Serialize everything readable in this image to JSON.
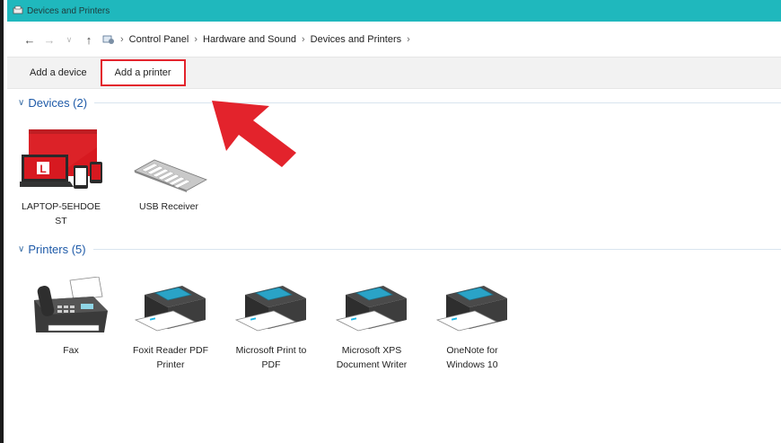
{
  "window": {
    "title": "Devices and Printers"
  },
  "address": {
    "back_icon": "arrow-left-icon",
    "forward_icon": "arrow-right-icon",
    "recent_icon": "chevron-down-icon",
    "up_icon": "arrow-up-icon",
    "crumbs": [
      "Control Panel",
      "Hardware and Sound",
      "Devices and Printers"
    ]
  },
  "commands": {
    "add_device": "Add a device",
    "add_printer": "Add a printer"
  },
  "devices": {
    "header": "Devices (2)",
    "items": [
      {
        "label": "LAPTOP-5EHDOE ST",
        "icon": "laptop-icon"
      },
      {
        "label": "USB Receiver",
        "icon": "keyboard-icon"
      }
    ]
  },
  "printers": {
    "header": "Printers (5)",
    "items": [
      {
        "label": "Fax",
        "icon": "fax-icon"
      },
      {
        "label": "Foxit Reader PDF Printer",
        "icon": "printer-icon"
      },
      {
        "label": "Microsoft Print to PDF",
        "icon": "printer-icon"
      },
      {
        "label": "Microsoft XPS Document Writer",
        "icon": "printer-icon"
      },
      {
        "label": "OneNote for Windows 10",
        "icon": "printer-icon"
      }
    ]
  },
  "annotation": {
    "arrow_color": "#e3232c",
    "icon": "red-arrow-icon"
  },
  "colors": {
    "titlebar": "#1fb8bd",
    "group_header": "#1e5aa8",
    "highlight_border": "#e3232c"
  }
}
